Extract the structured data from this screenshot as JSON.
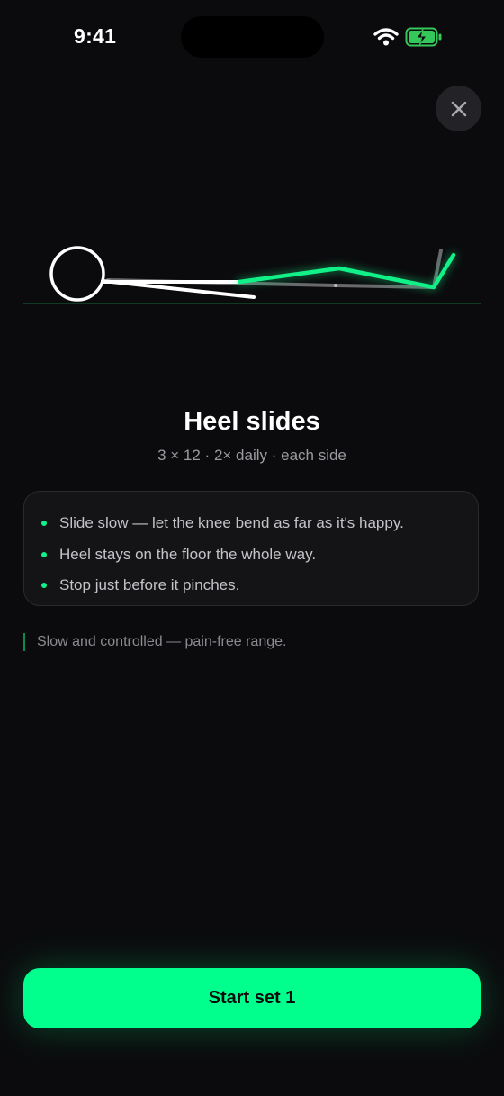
{
  "status_bar": {
    "time": "9:41",
    "icons": [
      "wifi-icon",
      "battery-charging-icon"
    ]
  },
  "close_button": {
    "icon": "close-icon"
  },
  "exercise": {
    "title": "Heel slides",
    "subtitle": "3 × 12 · 2× daily · each side",
    "tips": [
      "Slide slow — let the knee bend as far as it's happy.",
      "Heel stays on the floor the whole way.",
      "Stop just before it pinches."
    ],
    "note": "Slow and controlled — pain-free range."
  },
  "start_button": {
    "label": "Start set 1"
  },
  "colors": {
    "accent": "#00ff8c",
    "background": "#0b0b0d",
    "card": "#141416",
    "text_secondary": "#9a9aa0"
  }
}
